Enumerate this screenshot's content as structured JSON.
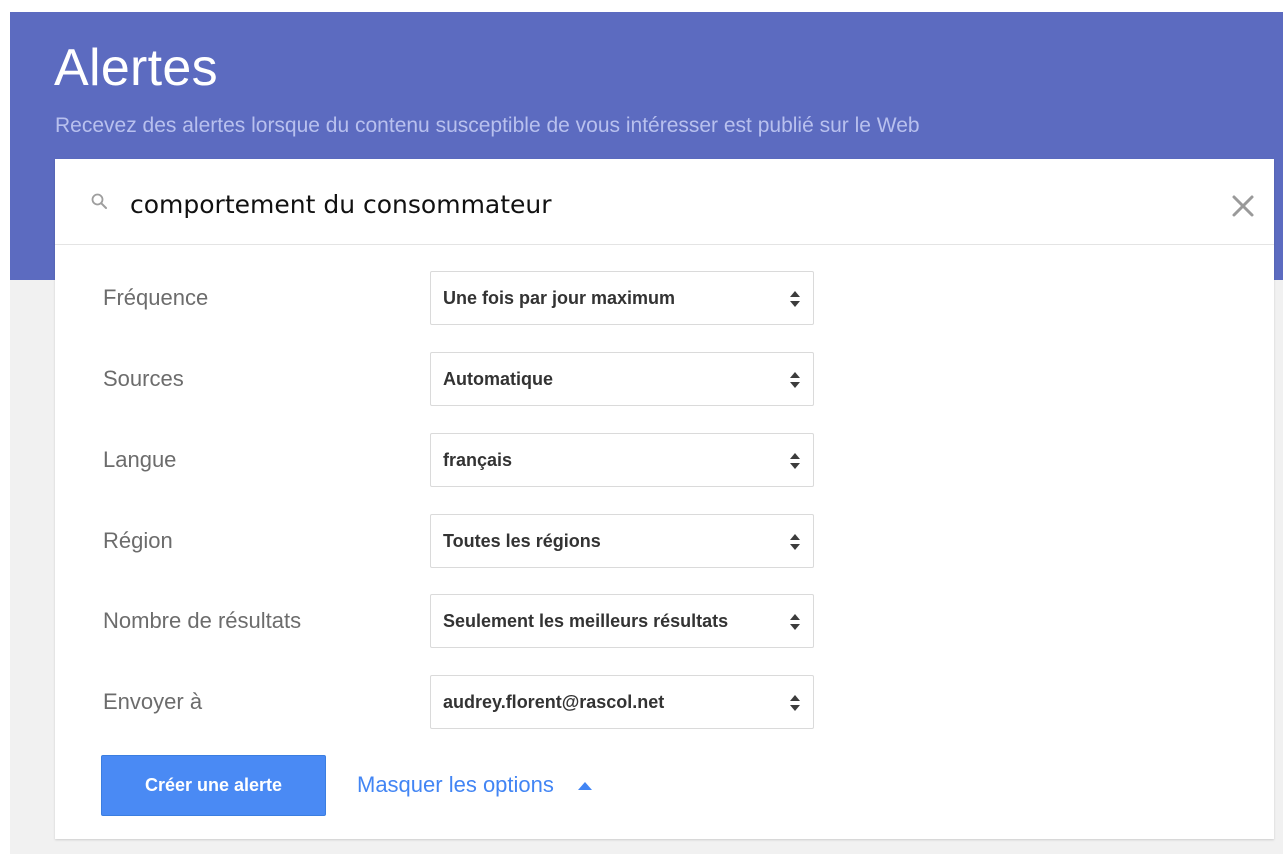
{
  "header": {
    "title": "Alertes",
    "subtitle": "Recevez des alertes lorsque du contenu susceptible de vous intéresser est publié sur le Web"
  },
  "search": {
    "value": "comportement du consommateur",
    "icon": "search-icon",
    "clear_icon": "close-icon"
  },
  "options": {
    "frequency": {
      "label": "Fréquence",
      "value": "Une fois par jour maximum"
    },
    "sources": {
      "label": "Sources",
      "value": "Automatique"
    },
    "language": {
      "label": "Langue",
      "value": "français"
    },
    "region": {
      "label": "Région",
      "value": "Toutes les régions"
    },
    "results": {
      "label": "Nombre de résultats",
      "value": "Seulement les meilleurs résultats"
    },
    "deliver": {
      "label": "Envoyer à",
      "value": "audrey.florent@rascol.net"
    }
  },
  "actions": {
    "create_label": "Créer une alerte",
    "toggle_label": "Masquer les options"
  },
  "colors": {
    "header_bg": "#5c6bc0",
    "subtitle": "#b8c0ee",
    "primary_button": "#4a8af4",
    "link": "#4285f4",
    "page_bg": "#f1f1f1"
  }
}
